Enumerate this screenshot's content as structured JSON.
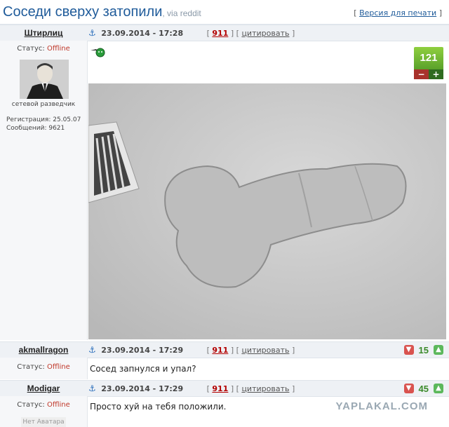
{
  "page": {
    "title": "Соседи сверху затопили",
    "via": ", via reddit",
    "print_prefix": "[",
    "print_label": "Версия для печати",
    "print_suffix": "]"
  },
  "posts": [
    {
      "author": "Штирлиц",
      "date": "23.09.2014 - 17:28",
      "post_num": "911",
      "quote_label": "цитировать",
      "status_label": "Статус:",
      "status_value": "Offline",
      "user_title": "сетевой разведчик",
      "reg_label": "Регистрация:",
      "reg_date": "25.05.07",
      "msgs_label": "Сообщений:",
      "msgs": "9621",
      "rating": "121",
      "minus": "−",
      "plus": "+"
    },
    {
      "author": "akmallragon",
      "date": "23.09.2014 - 17:29",
      "post_num": "911",
      "quote_label": "цитировать",
      "status_label": "Статус:",
      "status_value": "Offline",
      "text": "Сосед запнулся и упал?",
      "rating": "15"
    },
    {
      "author": "Modigar",
      "date": "23.09.2014 - 17:29",
      "post_num": "911",
      "quote_label": "цитировать",
      "status_label": "Статус:",
      "status_value": "Offline",
      "text": "Просто хуй на тебя положили.",
      "rating": "45",
      "no_avatar": "Нет Аватара"
    }
  ],
  "watermark": "YAPLAKAL.COM",
  "colors": {
    "title": "#1f5b9a",
    "offline": "#c0392b",
    "rating_green": "#5aa12a"
  },
  "icons": [
    "anchor-icon",
    "thumb-down-icon",
    "thumb-up-icon",
    "smiley-icon"
  ]
}
